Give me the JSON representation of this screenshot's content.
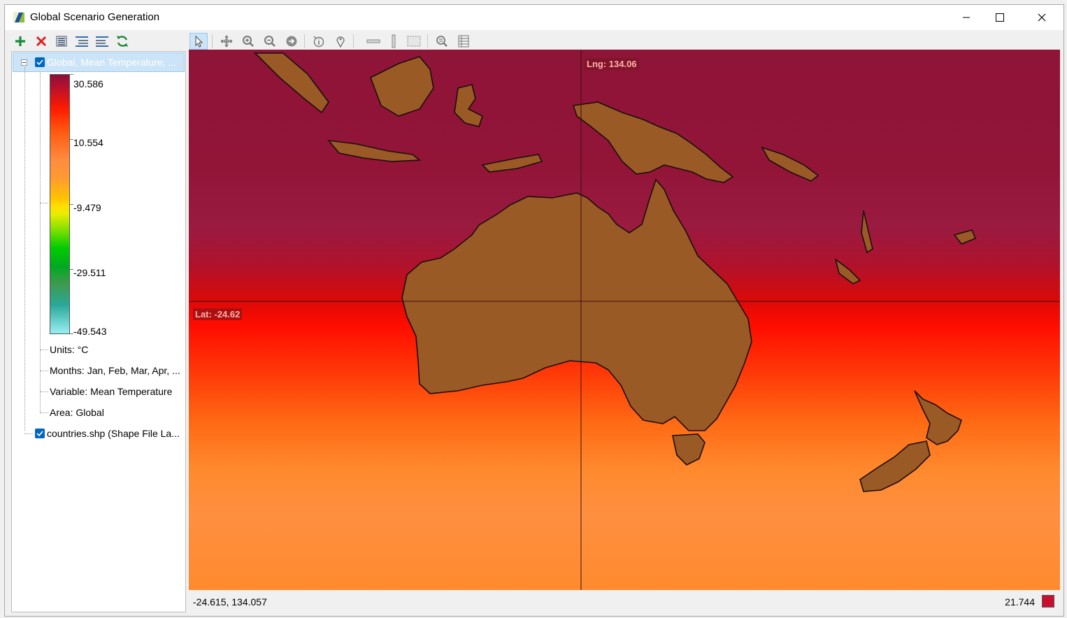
{
  "window": {
    "title": "Global Scenario Generation"
  },
  "layer_toolbar": {
    "buttons": [
      "add-layer",
      "remove-layer",
      "layer-properties",
      "expand-all",
      "collapse-all",
      "refresh"
    ]
  },
  "layers": {
    "scenario_layer": {
      "label": "Global, Mean Temperature, ...",
      "checked": true,
      "legend": {
        "labels": [
          "30.586",
          "10.554",
          "-9.479",
          "-29.511",
          "-49.543"
        ]
      },
      "units": "Units: °C",
      "months": "Months: Jan, Feb, Mar, Apr, ...",
      "variable": "Variable: Mean Temperature",
      "area": "Area: Global"
    },
    "shape_layer": {
      "label": "countries.shp (Shape File La...",
      "checked": true
    }
  },
  "map_toolbar": {
    "tools": [
      "select",
      "pan",
      "zoom-in",
      "zoom-out",
      "zoom-previous",
      "identify",
      "place-marker",
      "measure-distance",
      "measure-vertical",
      "select-region",
      "zoom-to-extent",
      "attribute-table"
    ],
    "active_tool": "select"
  },
  "map": {
    "lng_label": "Lng: 134.06",
    "lat_label": "Lat: -24.62"
  },
  "status": {
    "coords": "-24.615, 134.057",
    "value": "21.744",
    "value_color": "#c8102e"
  }
}
